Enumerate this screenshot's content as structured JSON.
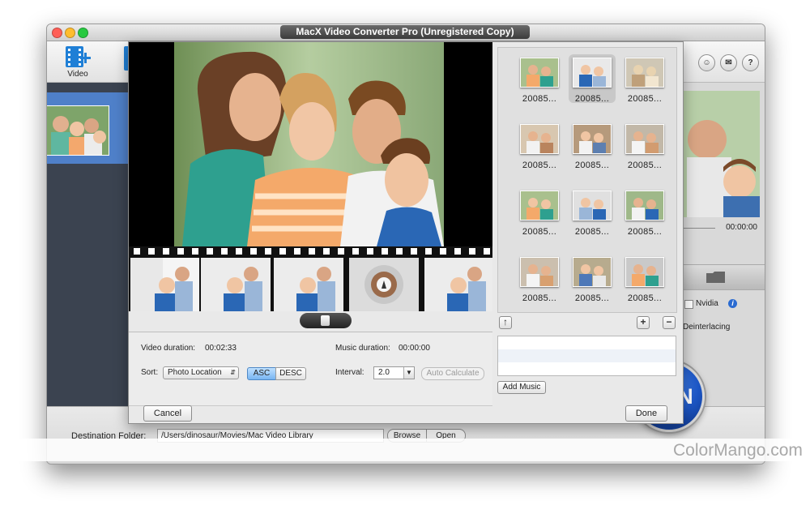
{
  "window": {
    "title": "MacX Video Converter Pro (Unregistered Copy)"
  },
  "toolbar": {
    "video_label": "Video"
  },
  "header_icons": [
    "user-icon",
    "mail-icon",
    "help-icon"
  ],
  "right_panel": {
    "time": "00:00:00",
    "nvidia_label": "Nvidia",
    "deinterlacing_label": "Deinterlacing"
  },
  "run_label": "RUN",
  "bottom": {
    "destination_label": "Destination Folder:",
    "destination_value": "/Users/dinosaur/Movies/Mac Video Library",
    "browse_label": "Browse",
    "open_label": "Open"
  },
  "dialog": {
    "video_duration_label": "Video duration:",
    "video_duration_value": "00:02:33",
    "music_duration_label": "Music duration:",
    "music_duration_value": "00:00:00",
    "sort_label": "Sort:",
    "sort_value": "Photo Location",
    "asc_label": "ASC",
    "desc_label": "DESC",
    "interval_label": "Interval:",
    "interval_value": "2.0",
    "auto_calculate_label": "Auto Calculate",
    "add_music_label": "Add Music",
    "cancel_label": "Cancel",
    "done_label": "Done",
    "gallery": [
      {
        "caption": "20085...",
        "selected": false
      },
      {
        "caption": "20085...",
        "selected": true
      },
      {
        "caption": "20085...",
        "selected": false
      },
      {
        "caption": "20085...",
        "selected": false
      },
      {
        "caption": "20085...",
        "selected": false
      },
      {
        "caption": "20085...",
        "selected": false
      },
      {
        "caption": "20085...",
        "selected": false
      },
      {
        "caption": "20085...",
        "selected": false
      },
      {
        "caption": "20085...",
        "selected": false
      },
      {
        "caption": "20085...",
        "selected": false
      },
      {
        "caption": "20085...",
        "selected": false
      },
      {
        "caption": "20085...",
        "selected": false
      }
    ]
  },
  "watermark": "ColorMango.com"
}
